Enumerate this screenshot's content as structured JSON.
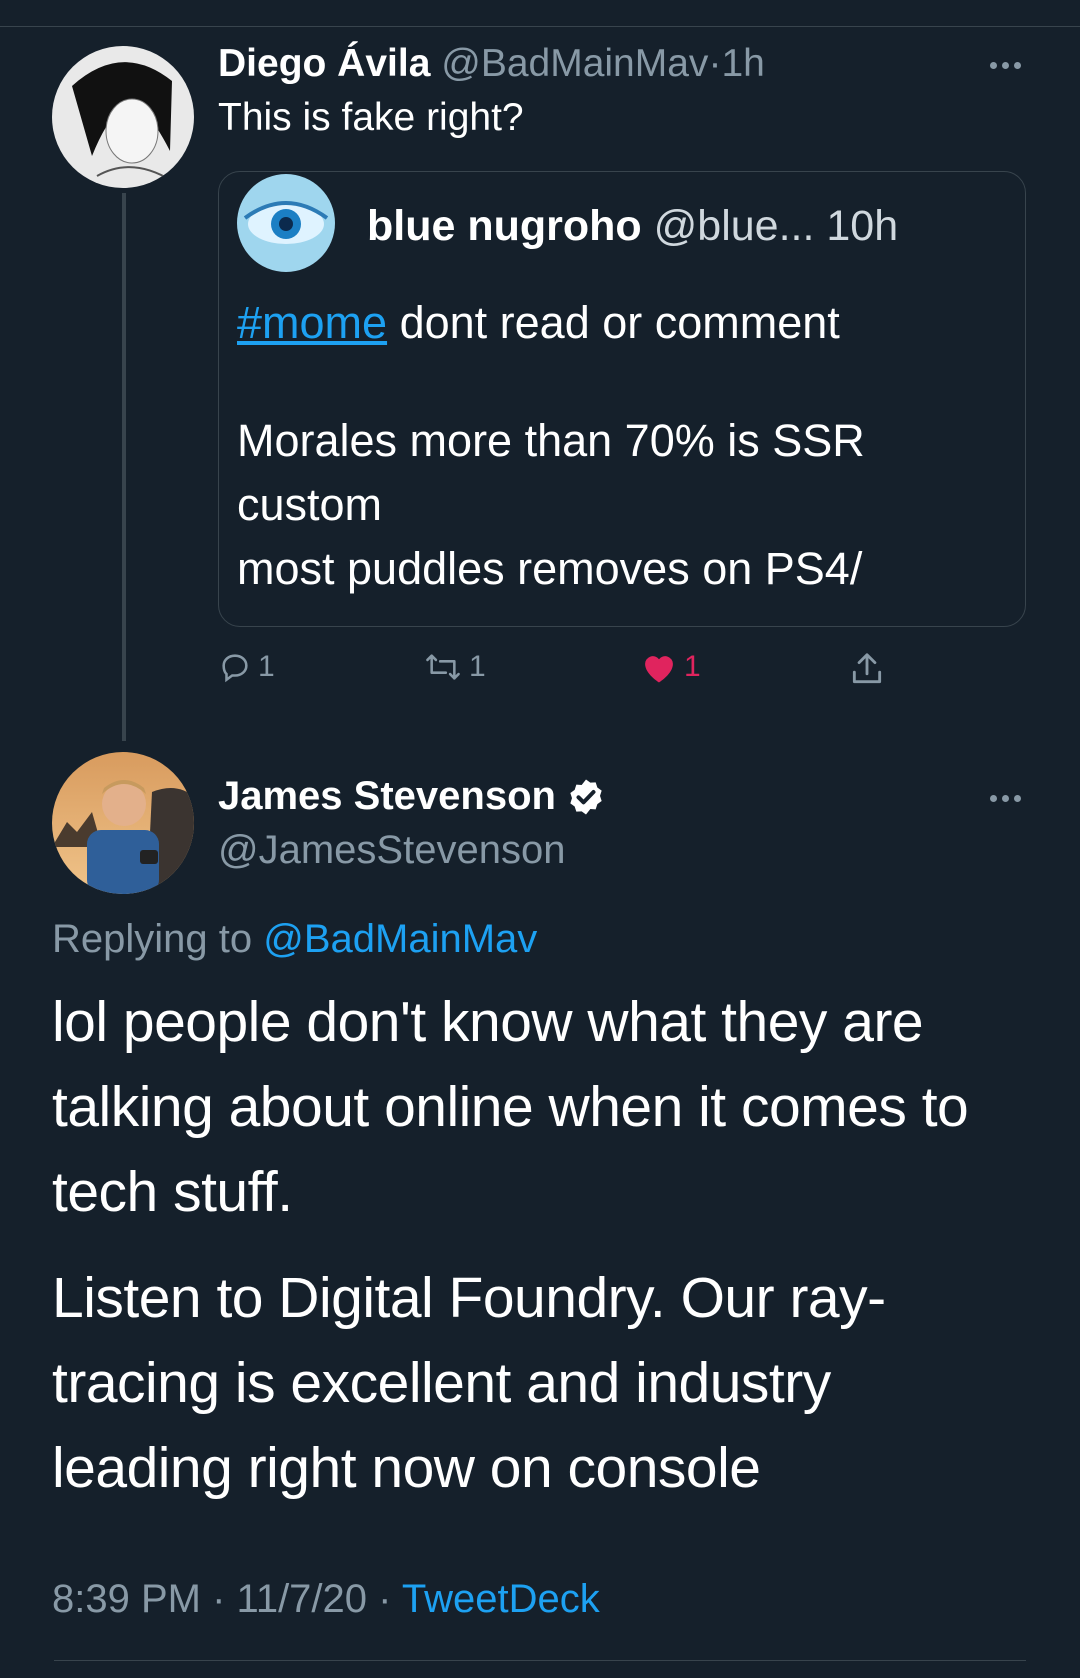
{
  "parent_tweet": {
    "author_name": "Diego Ávila",
    "handle": "@BadMainMav",
    "separator": "·",
    "time": "1h",
    "text": "This is fake right?",
    "quoted": {
      "author_name": "blue nugroho",
      "handle": "@blue...",
      "time": "10h",
      "hashtag": "#mome",
      "line1_rest": " dont read or comment",
      "body": "Morales more than 70% is SSR\ncustom\nmost puddles removes on PS4/"
    },
    "actions": {
      "reply_count": "1",
      "retweet_count": "1",
      "like_count": "1"
    }
  },
  "reply_tweet": {
    "author_name": "James Stevenson",
    "handle": "@JamesStevenson",
    "verified": true,
    "replying_prefix": "Replying to ",
    "replying_to": "@BadMainMav",
    "paragraph1": "lol people don't know what they are talking about online when it comes to tech stuff.",
    "paragraph2": "Listen to Digital Foundry. Our ray-tracing is excellent and industry leading right now on console",
    "time": "8:39 PM",
    "date": "11/7/20",
    "source": "TweetDeck",
    "separator": "·"
  },
  "colors": {
    "background": "#15202b",
    "muted": "#8899a6",
    "link": "#1da1f2",
    "like": "#e0245e",
    "divider": "#38444d"
  },
  "icons": [
    "more-icon",
    "reply-icon",
    "retweet-icon",
    "like-icon",
    "share-icon",
    "verified-badge-icon"
  ]
}
